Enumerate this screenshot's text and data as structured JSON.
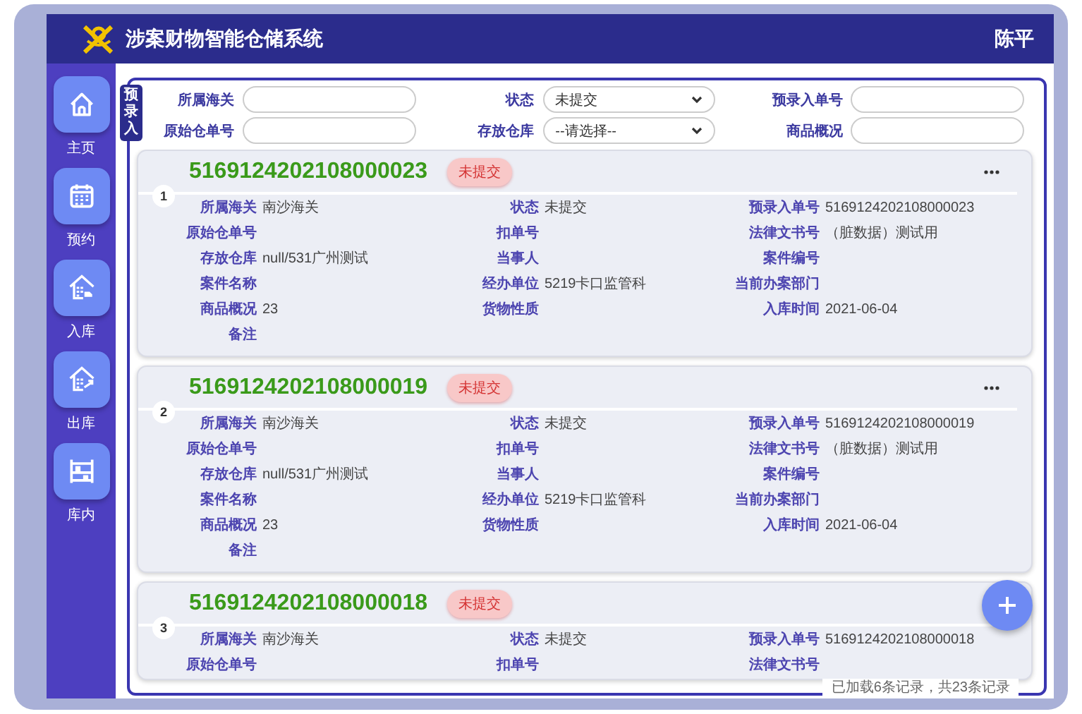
{
  "header": {
    "title": "涉案财物智能仓储系统",
    "user": "陈平"
  },
  "sidebar": [
    {
      "label": "主页"
    },
    {
      "label": "预约"
    },
    {
      "label": "入库"
    },
    {
      "label": "出库"
    },
    {
      "label": "库内"
    }
  ],
  "panel": {
    "tab": "预录入",
    "filters": [
      {
        "label": "所属海关",
        "kind": "input"
      },
      {
        "label": "状态",
        "kind": "select",
        "value": "未提交"
      },
      {
        "label": "预录入单号",
        "kind": "input"
      },
      {
        "label": "原始仓单号",
        "kind": "input"
      },
      {
        "label": "存放仓库",
        "kind": "select",
        "value": "--请选择--"
      },
      {
        "label": "商品概况",
        "kind": "input"
      }
    ],
    "records": [
      {
        "index": "1",
        "title": "5169124202108000023",
        "status": "未提交",
        "fields": [
          {
            "label": "所属海关",
            "value": "南沙海关"
          },
          {
            "label": "状态",
            "value": "未提交"
          },
          {
            "label": "预录入单号",
            "value": "5169124202108000023"
          },
          {
            "label": "原始仓单号"
          },
          {
            "label": "扣单号"
          },
          {
            "label": "法律文书号",
            "value": "（脏数据）测试用"
          },
          {
            "label": "存放仓库",
            "value": "null/531广州测试"
          },
          {
            "label": "当事人"
          },
          {
            "label": "案件编号"
          },
          {
            "label": "案件名称"
          },
          {
            "label": "经办单位",
            "value": "5219卡口监管科"
          },
          {
            "label": "当前办案部门"
          },
          {
            "label": "商品概况",
            "value": "23"
          },
          {
            "label": "货物性质"
          },
          {
            "label": "入库时间",
            "value": "2021-06-04"
          },
          {
            "label": "备注"
          }
        ]
      },
      {
        "index": "2",
        "title": "5169124202108000019",
        "status": "未提交",
        "fields": [
          {
            "label": "所属海关",
            "value": "南沙海关"
          },
          {
            "label": "状态",
            "value": "未提交"
          },
          {
            "label": "预录入单号",
            "value": "5169124202108000019"
          },
          {
            "label": "原始仓单号"
          },
          {
            "label": "扣单号"
          },
          {
            "label": "法律文书号",
            "value": "（脏数据）测试用"
          },
          {
            "label": "存放仓库",
            "value": "null/531广州测试"
          },
          {
            "label": "当事人"
          },
          {
            "label": "案件编号"
          },
          {
            "label": "案件名称"
          },
          {
            "label": "经办单位",
            "value": "5219卡口监管科"
          },
          {
            "label": "当前办案部门"
          },
          {
            "label": "商品概况",
            "value": "23"
          },
          {
            "label": "货物性质"
          },
          {
            "label": "入库时间",
            "value": "2021-06-04"
          },
          {
            "label": "备注"
          }
        ]
      },
      {
        "index": "3",
        "title": "5169124202108000018",
        "status": "未提交",
        "fields": [
          {
            "label": "所属海关",
            "value": "南沙海关"
          },
          {
            "label": "状态",
            "value": "未提交"
          },
          {
            "label": "预录入单号",
            "value": "5169124202108000018"
          },
          {
            "label": "原始仓单号"
          },
          {
            "label": "扣单号"
          },
          {
            "label": "法律文书号"
          }
        ]
      }
    ],
    "footer": "已加载6条记录，共23条记录"
  }
}
